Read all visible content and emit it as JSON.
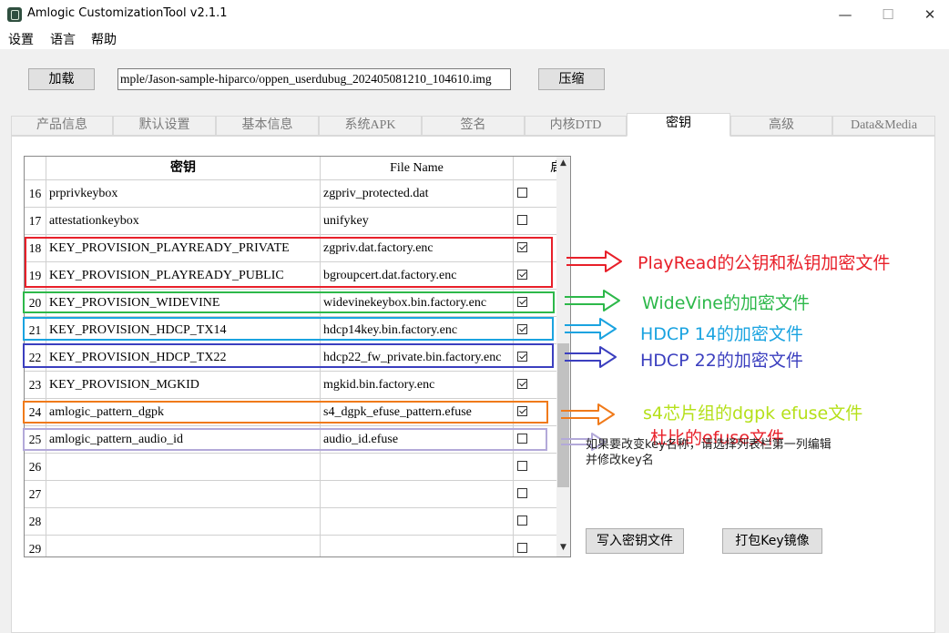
{
  "window": {
    "title": "Amlogic CustomizationTool v2.1.1",
    "minimize": "—",
    "maximize": "☐",
    "close": "✕"
  },
  "menu": [
    "设置",
    "语言",
    "帮助"
  ],
  "toolbar": {
    "load_label": "加载",
    "path_value": "mple/Jason-sample-hiparco/oppen_userdubug_202405081210_104610.img",
    "compress_label": "压缩"
  },
  "tabs": [
    "产品信息",
    "默认设置",
    "基本信息",
    "系统APK",
    "签名",
    "内核DTD",
    "密钥",
    "高级",
    "Data&Media"
  ],
  "active_tab": "密钥",
  "table": {
    "columns": [
      "密钥",
      "File Name",
      "启"
    ],
    "rows": [
      {
        "num": "16",
        "key": "prprivkeybox",
        "file": "zgpriv_protected.dat",
        "checked": false
      },
      {
        "num": "17",
        "key": "attestationkeybox",
        "file": "unifykey",
        "checked": false
      },
      {
        "num": "18",
        "key": "KEY_PROVISION_PLAYREADY_PRIVATE",
        "file": "zgpriv.dat.factory.enc",
        "checked": true
      },
      {
        "num": "19",
        "key": "KEY_PROVISION_PLAYREADY_PUBLIC",
        "file": "bgroupcert.dat.factory.enc",
        "checked": true
      },
      {
        "num": "20",
        "key": "KEY_PROVISION_WIDEVINE",
        "file": "widevinekeybox.bin.factory.enc",
        "checked": true
      },
      {
        "num": "21",
        "key": "KEY_PROVISION_HDCP_TX14",
        "file": "hdcp14key.bin.factory.enc",
        "checked": true
      },
      {
        "num": "22",
        "key": "KEY_PROVISION_HDCP_TX22",
        "file": "hdcp22_fw_private.bin.factory.enc",
        "checked": true
      },
      {
        "num": "23",
        "key": "KEY_PROVISION_MGKID",
        "file": "mgkid.bin.factory.enc",
        "checked": true
      },
      {
        "num": "24",
        "key": "amlogic_pattern_dgpk",
        "file": "s4_dgpk_efuse_pattern.efuse",
        "checked": true
      },
      {
        "num": "25",
        "key": "amlogic_pattern_audio_id",
        "file": "audio_id.efuse",
        "checked": false
      },
      {
        "num": "26",
        "key": "",
        "file": "",
        "checked": false
      },
      {
        "num": "27",
        "key": "",
        "file": "",
        "checked": false
      },
      {
        "num": "28",
        "key": "",
        "file": "",
        "checked": false
      },
      {
        "num": "29",
        "key": "",
        "file": "",
        "checked": false
      }
    ]
  },
  "annotations": {
    "playready": "PlayRead的公钥和私钥加密文件",
    "widevine": "WideVine的加密文件",
    "hdcp14": "HDCP 14的加密文件",
    "hdcp22": "HDCP 22的加密文件",
    "dgpk": "s4芯片组的dgpk efuse文件",
    "audio": "杜比的efuse文件",
    "colors": {
      "playready": "#e8202a",
      "widevine": "#2db84a",
      "hdcp14": "#1aa3e0",
      "hdcp22": "#3b3fbf",
      "dgpk": "#f07a1a",
      "dgpk_text": "#b5e01a",
      "audio": "#b3a9d9"
    }
  },
  "hint": "如果要改变key名称，请选择列表栏第一列编辑并修改key名",
  "buttons": {
    "write_key": "写入密钥文件",
    "pack_key": "打包Key镜像"
  }
}
